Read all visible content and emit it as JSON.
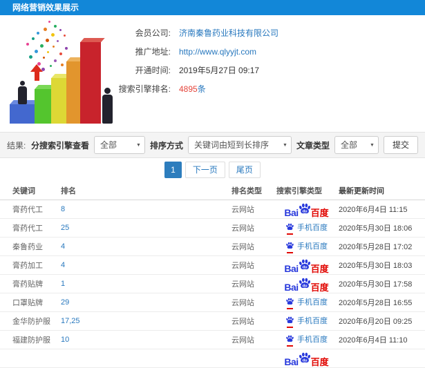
{
  "colors": {
    "header_bg": "#1287d8",
    "link": "#2878be",
    "highlight_red": "#e4443a",
    "baidu_blue": "#2839dc",
    "baidu_red": "#e10602",
    "page_active_bg": "#2d7dbd",
    "filter_bar_bg": "#f4f4f4"
  },
  "titlebar": {
    "title": "网络营销效果展示"
  },
  "info": {
    "member_label": "会员公司:",
    "member_value": "济南秦鲁药业科技有限公司",
    "url_label": "推广地址:",
    "url_value": "http://www.qlyyjt.com",
    "open_label": "开通时间:",
    "open_value": "2019年5月27日 09:17",
    "rank_label": "搜索引擎排名:",
    "rank_count": "4895",
    "rank_unit": "条"
  },
  "filters": {
    "result_label": "结果:",
    "engine_label": "分搜索引擎查看",
    "engine_value": "全部",
    "sort_label": "排序方式",
    "sort_value": "关键词由短到长排序",
    "article_label": "文章类型",
    "article_value": "全部",
    "submit_label": "提交",
    "caret": "▼"
  },
  "pagination": {
    "current": "1",
    "next_label": "下一页",
    "last_label": "尾页"
  },
  "engine_logos": {
    "baidu_pc_prefix": "Bai",
    "baidu_pc_suffix": "百度",
    "baidu_mobile_label": "手机百度"
  },
  "table": {
    "headers": [
      "关键词",
      "排名",
      "排名类型",
      "搜索引擎类型",
      "最新更新时间"
    ],
    "rows": [
      {
        "keyword": "膏药代工",
        "rank": "8",
        "rank_type": "云网站",
        "engine": "baidu-pc",
        "updated": "2020年6月4日 11:15"
      },
      {
        "keyword": "膏药代工",
        "rank": "25",
        "rank_type": "云网站",
        "engine": "baidu-mobile",
        "updated": "2020年5月30日 18:06"
      },
      {
        "keyword": "秦鲁药业",
        "rank": "4",
        "rank_type": "云网站",
        "engine": "baidu-mobile",
        "updated": "2020年5月28日 17:02"
      },
      {
        "keyword": "膏药加工",
        "rank": "4",
        "rank_type": "云网站",
        "engine": "baidu-pc",
        "updated": "2020年5月30日 18:03"
      },
      {
        "keyword": "膏药贴牌",
        "rank": "1",
        "rank_type": "云网站",
        "engine": "baidu-pc",
        "updated": "2020年5月30日 17:58"
      },
      {
        "keyword": "口罩贴牌",
        "rank": "29",
        "rank_type": "云网站",
        "engine": "baidu-mobile",
        "updated": "2020年5月28日 16:55"
      },
      {
        "keyword": "金华防护服",
        "rank": "17,25",
        "rank_type": "云网站",
        "engine": "baidu-mobile",
        "updated": "2020年6月20日 09:25"
      },
      {
        "keyword": "福建防护服",
        "rank": "10",
        "rank_type": "云网站",
        "engine": "baidu-mobile",
        "updated": "2020年6月4日 11:10"
      },
      {
        "keyword": "",
        "rank": "",
        "rank_type": "",
        "engine": "baidu-pc",
        "updated": ""
      }
    ]
  }
}
